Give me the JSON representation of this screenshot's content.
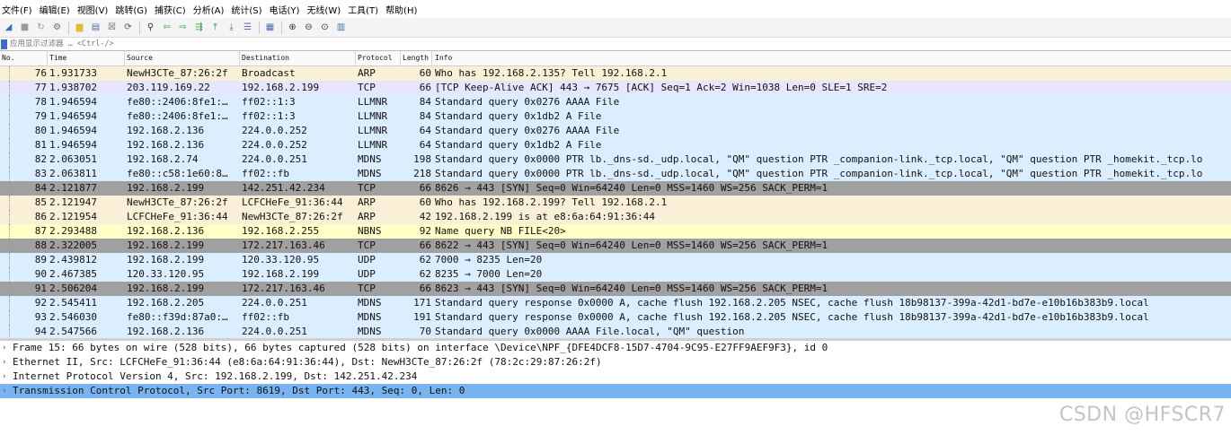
{
  "menu": [
    "文件(F)",
    "编辑(E)",
    "视图(V)",
    "跳转(G)",
    "捕获(C)",
    "分析(A)",
    "统计(S)",
    "电话(Y)",
    "无线(W)",
    "工具(T)",
    "帮助(H)"
  ],
  "toolbar": [
    {
      "name": "shark-fin-start-icon",
      "glyph": "◢",
      "color": "#2e6ec4"
    },
    {
      "name": "stop-capture-icon",
      "glyph": "■",
      "color": "#9a9a9a"
    },
    {
      "name": "restart-capture-icon",
      "glyph": "↻",
      "color": "#9a9a9a"
    },
    {
      "name": "capture-options-icon",
      "glyph": "⚙",
      "color": "#6a6a6a"
    },
    {
      "name": "sep"
    },
    {
      "name": "open-file-icon",
      "glyph": "▆",
      "color": "#e6b840"
    },
    {
      "name": "save-file-icon",
      "glyph": "▤",
      "color": "#4a6fa8"
    },
    {
      "name": "close-file-icon",
      "glyph": "☒",
      "color": "#4a5a78"
    },
    {
      "name": "reload-file-icon",
      "glyph": "⟳",
      "color": "#4a5a78"
    },
    {
      "name": "sep"
    },
    {
      "name": "find-packet-icon",
      "glyph": "⚲",
      "color": "#333333"
    },
    {
      "name": "go-back-icon",
      "glyph": "⇦",
      "color": "#2f9c3c"
    },
    {
      "name": "go-forward-icon",
      "glyph": "⇨",
      "color": "#2f9c3c"
    },
    {
      "name": "go-to-packet-icon",
      "glyph": "⇶",
      "color": "#2f9c3c"
    },
    {
      "name": "go-first-icon",
      "glyph": "⤒",
      "color": "#2f9c3c"
    },
    {
      "name": "go-last-icon",
      "glyph": "⤓",
      "color": "#2f9c3c"
    },
    {
      "name": "auto-scroll-icon",
      "glyph": "☰",
      "color": "#4a6fa8"
    },
    {
      "name": "sep"
    },
    {
      "name": "colorize-icon",
      "glyph": "▦",
      "color": "#4a6fa8"
    },
    {
      "name": "sep"
    },
    {
      "name": "zoom-in-icon",
      "glyph": "⊕",
      "color": "#333333"
    },
    {
      "name": "zoom-out-icon",
      "glyph": "⊖",
      "color": "#333333"
    },
    {
      "name": "zoom-normal-icon",
      "glyph": "⊙",
      "color": "#333333"
    },
    {
      "name": "resize-columns-icon",
      "glyph": "▥",
      "color": "#4a6fa8"
    }
  ],
  "filter": {
    "placeholder": "应用显示过滤器 … <Ctrl-/>"
  },
  "columns": {
    "no": "No.",
    "time": "Time",
    "source": "Source",
    "destination": "Destination",
    "protocol": "Protocol",
    "length": "Length",
    "info": "Info"
  },
  "colors": {
    "arp": "#faf0d7",
    "tcp_ack": "#e7e6ff",
    "udp": "#daeeff",
    "tcp_syn": "#a0a0a0",
    "nbns": "#ffffc8"
  },
  "packets": [
    {
      "no": "76",
      "time": "1.931733",
      "src": "NewH3CTe_87:26:2f",
      "dst": "Broadcast",
      "proto": "ARP",
      "len": "60",
      "info": "Who has 192.168.2.135? Tell 192.168.2.1",
      "bg": "#faf0d7"
    },
    {
      "no": "77",
      "time": "1.938702",
      "src": "203.119.169.22",
      "dst": "192.168.2.199",
      "proto": "TCP",
      "len": "66",
      "info": "[TCP Keep-Alive ACK] 443 → 7675 [ACK] Seq=1 Ack=2 Win=1038 Len=0 SLE=1 SRE=2",
      "bg": "#e7e6ff"
    },
    {
      "no": "78",
      "time": "1.946594",
      "src": "fe80::2406:8fe1:…",
      "dst": "ff02::1:3",
      "proto": "LLMNR",
      "len": "84",
      "info": "Standard query 0x0276 AAAA File",
      "bg": "#daeeff"
    },
    {
      "no": "79",
      "time": "1.946594",
      "src": "fe80::2406:8fe1:…",
      "dst": "ff02::1:3",
      "proto": "LLMNR",
      "len": "84",
      "info": "Standard query 0x1db2 A File",
      "bg": "#daeeff"
    },
    {
      "no": "80",
      "time": "1.946594",
      "src": "192.168.2.136",
      "dst": "224.0.0.252",
      "proto": "LLMNR",
      "len": "64",
      "info": "Standard query 0x0276 AAAA File",
      "bg": "#daeeff"
    },
    {
      "no": "81",
      "time": "1.946594",
      "src": "192.168.2.136",
      "dst": "224.0.0.252",
      "proto": "LLMNR",
      "len": "64",
      "info": "Standard query 0x1db2 A File",
      "bg": "#daeeff"
    },
    {
      "no": "82",
      "time": "2.063051",
      "src": "192.168.2.74",
      "dst": "224.0.0.251",
      "proto": "MDNS",
      "len": "198",
      "info": "Standard query 0x0000 PTR lb._dns-sd._udp.local, \"QM\" question PTR _companion-link._tcp.local, \"QM\" question PTR _homekit._tcp.lo",
      "bg": "#daeeff"
    },
    {
      "no": "83",
      "time": "2.063811",
      "src": "fe80::c58:1e60:8…",
      "dst": "ff02::fb",
      "proto": "MDNS",
      "len": "218",
      "info": "Standard query 0x0000 PTR lb._dns-sd._udp.local, \"QM\" question PTR _companion-link._tcp.local, \"QM\" question PTR _homekit._tcp.lo",
      "bg": "#daeeff"
    },
    {
      "no": "84",
      "time": "2.121877",
      "src": "192.168.2.199",
      "dst": "142.251.42.234",
      "proto": "TCP",
      "len": "66",
      "info": "8626 → 443 [SYN] Seq=0 Win=64240 Len=0 MSS=1460 WS=256 SACK_PERM=1",
      "bg": "#a0a0a0"
    },
    {
      "no": "85",
      "time": "2.121947",
      "src": "NewH3CTe_87:26:2f",
      "dst": "LCFCHeFe_91:36:44",
      "proto": "ARP",
      "len": "60",
      "info": "Who has 192.168.2.199? Tell 192.168.2.1",
      "bg": "#faf0d7"
    },
    {
      "no": "86",
      "time": "2.121954",
      "src": "LCFCHeFe_91:36:44",
      "dst": "NewH3CTe_87:26:2f",
      "proto": "ARP",
      "len": "42",
      "info": "192.168.2.199 is at e8:6a:64:91:36:44",
      "bg": "#faf0d7"
    },
    {
      "no": "87",
      "time": "2.293488",
      "src": "192.168.2.136",
      "dst": "192.168.2.255",
      "proto": "NBNS",
      "len": "92",
      "info": "Name query NB FILE<20>",
      "bg": "#ffffc8"
    },
    {
      "no": "88",
      "time": "2.322005",
      "src": "192.168.2.199",
      "dst": "172.217.163.46",
      "proto": "TCP",
      "len": "66",
      "info": "8622 → 443 [SYN] Seq=0 Win=64240 Len=0 MSS=1460 WS=256 SACK_PERM=1",
      "bg": "#a0a0a0"
    },
    {
      "no": "89",
      "time": "2.439812",
      "src": "192.168.2.199",
      "dst": "120.33.120.95",
      "proto": "UDP",
      "len": "62",
      "info": "7000 → 8235 Len=20",
      "bg": "#daeeff"
    },
    {
      "no": "90",
      "time": "2.467385",
      "src": "120.33.120.95",
      "dst": "192.168.2.199",
      "proto": "UDP",
      "len": "62",
      "info": "8235 → 7000 Len=20",
      "bg": "#daeeff"
    },
    {
      "no": "91",
      "time": "2.506204",
      "src": "192.168.2.199",
      "dst": "172.217.163.46",
      "proto": "TCP",
      "len": "66",
      "info": "8623 → 443 [SYN] Seq=0 Win=64240 Len=0 MSS=1460 WS=256 SACK_PERM=1",
      "bg": "#a0a0a0"
    },
    {
      "no": "92",
      "time": "2.545411",
      "src": "192.168.2.205",
      "dst": "224.0.0.251",
      "proto": "MDNS",
      "len": "171",
      "info": "Standard query response 0x0000 A, cache flush 192.168.2.205 NSEC, cache flush 18b98137-399a-42d1-bd7e-e10b16b383b9.local",
      "bg": "#daeeff"
    },
    {
      "no": "93",
      "time": "2.546030",
      "src": "fe80::f39d:87a0:…",
      "dst": "ff02::fb",
      "proto": "MDNS",
      "len": "191",
      "info": "Standard query response 0x0000 A, cache flush 192.168.2.205 NSEC, cache flush 18b98137-399a-42d1-bd7e-e10b16b383b9.local",
      "bg": "#daeeff"
    },
    {
      "no": "94",
      "time": "2.547566",
      "src": "192.168.2.136",
      "dst": "224.0.0.251",
      "proto": "MDNS",
      "len": "70",
      "info": "Standard query 0x0000 AAAA File.local, \"QM\" question",
      "bg": "#daeeff"
    }
  ],
  "details": [
    {
      "text": "Frame 15: 66 bytes on wire (528 bits), 66 bytes captured (528 bits) on interface \\Device\\NPF_{DFE4DCF8-15D7-4704-9C95-E27FF9AEF9F3}, id 0",
      "selected": false
    },
    {
      "text": "Ethernet II, Src: LCFCHeFe_91:36:44 (e8:6a:64:91:36:44), Dst: NewH3CTe_87:26:2f (78:2c:29:87:26:2f)",
      "selected": false
    },
    {
      "text": "Internet Protocol Version 4, Src: 192.168.2.199, Dst: 142.251.42.234",
      "selected": false
    },
    {
      "text": "Transmission Control Protocol, Src Port: 8619, Dst Port: 443, Seq: 0, Len: 0",
      "selected": true
    }
  ],
  "watermark": "CSDN @HFSCR7"
}
